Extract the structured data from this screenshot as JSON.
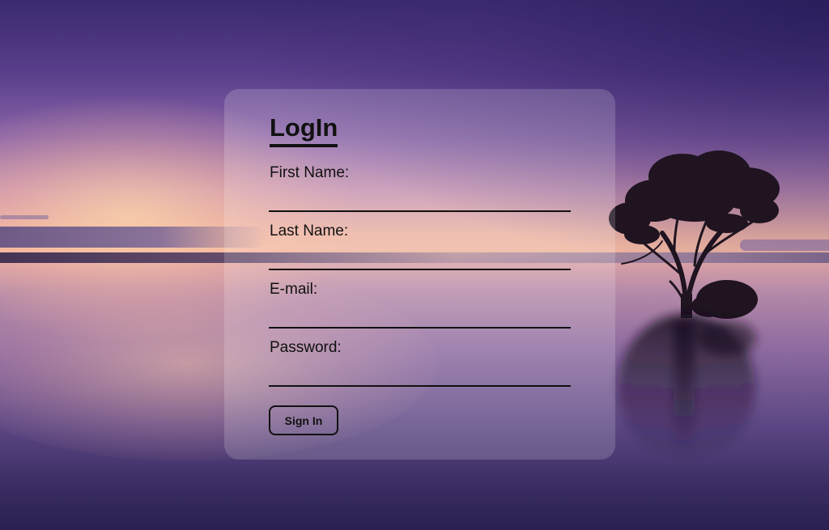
{
  "form": {
    "title": "LogIn",
    "fields": [
      {
        "label": "First Name:",
        "value": "",
        "type": "text"
      },
      {
        "label": "Last Name:",
        "value": "",
        "type": "text"
      },
      {
        "label": "E-mail:",
        "value": "",
        "type": "email"
      },
      {
        "label": "Password:",
        "value": "",
        "type": "password"
      }
    ],
    "submit_label": "Sign In"
  },
  "colors": {
    "text": "#111111",
    "card_overlay": "rgba(255,255,255,0.17)",
    "sky_top": "#3a2a6e",
    "horizon_glow": "#f0b7a0"
  }
}
